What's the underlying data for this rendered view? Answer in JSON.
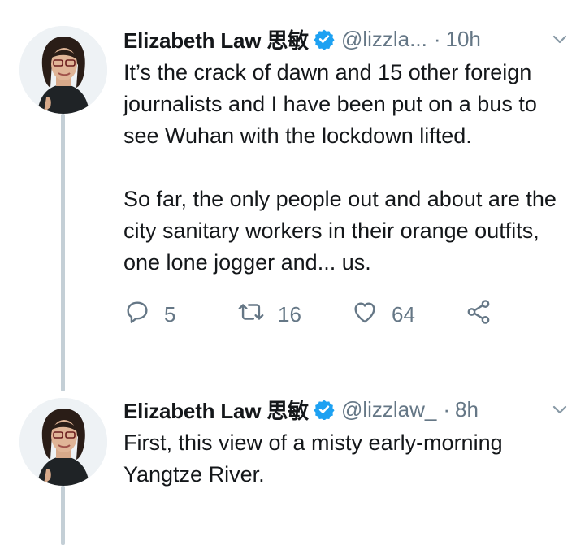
{
  "colors": {
    "text": "#14171a",
    "secondary": "#657786",
    "verified": "#1da1f2",
    "thread_line": "#c4cfd6"
  },
  "tweets": [
    {
      "author_name": "Elizabeth Law 思敏",
      "handle": "@lizzla...",
      "separator": "·",
      "time": "10h",
      "text": "It’s the crack of dawn and 15 other foreign journalists and I have been put on a bus to see Wuhan with the lockdown lifted.\n\nSo far, the only people out and about are the city sanitary workers in their orange outfits, one lone jogger and... us.",
      "replies": "5",
      "retweets": "16",
      "likes": "64",
      "icons": [
        "verified-badge-icon",
        "chevron-down-icon",
        "reply-icon",
        "retweet-icon",
        "like-icon",
        "share-icon"
      ]
    },
    {
      "author_name": "Elizabeth Law 思敏",
      "handle": "@lizzlaw_",
      "separator": "·",
      "time": "8h",
      "text": "First, this view of a misty early-morning Yangtze River.",
      "icons": [
        "verified-badge-icon",
        "chevron-down-icon"
      ]
    }
  ]
}
